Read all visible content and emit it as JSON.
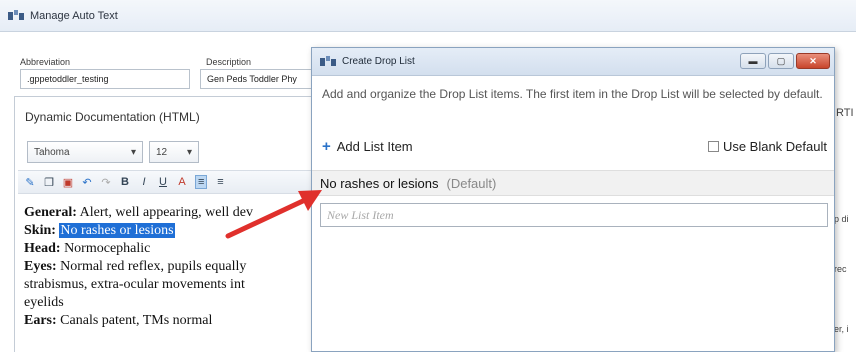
{
  "main_window": {
    "title": "Manage Auto Text",
    "abbreviation_label": "Abbreviation",
    "abbreviation_value": ".gppetoddler_testing",
    "description_label": "Description",
    "description_value": "Gen Peds Toddler Phy",
    "editor_header": "Dynamic Documentation (HTML)",
    "font_family": "Tahoma",
    "font_size": "12",
    "right_clip_header": "RTI",
    "right_clip_texts": [
      "p di",
      "rec",
      "er, i"
    ]
  },
  "note": {
    "general_label": "General:",
    "general_text": "Alert, well appearing, well dev",
    "skin_label": "Skin:",
    "skin_text": "No rashes or lesions",
    "head_label": "Head:",
    "head_text": "Normocephalic",
    "eyes_label": "Eyes:",
    "eyes_text": "Normal red reflex, pupils equally",
    "eyes_text_2": "strabismus, extra-ocular movements int",
    "eyes_text_3": "eyelids",
    "ears_label": "Ears:",
    "ears_text": "Canals patent, TMs normal"
  },
  "dialog": {
    "title": "Create Drop List",
    "description": "Add and organize the Drop List items. The first item in the Drop List will be selected by default.",
    "add_item_label": "Add List Item",
    "blank_default_label": "Use Blank Default",
    "item_text": "No rashes or lesions",
    "item_default_tag": "(Default)",
    "new_item_placeholder": "New List Item"
  },
  "colors": {
    "highlight": "#1f6fd6",
    "arrow": "#e0302c",
    "close_button": "#c8452c"
  }
}
